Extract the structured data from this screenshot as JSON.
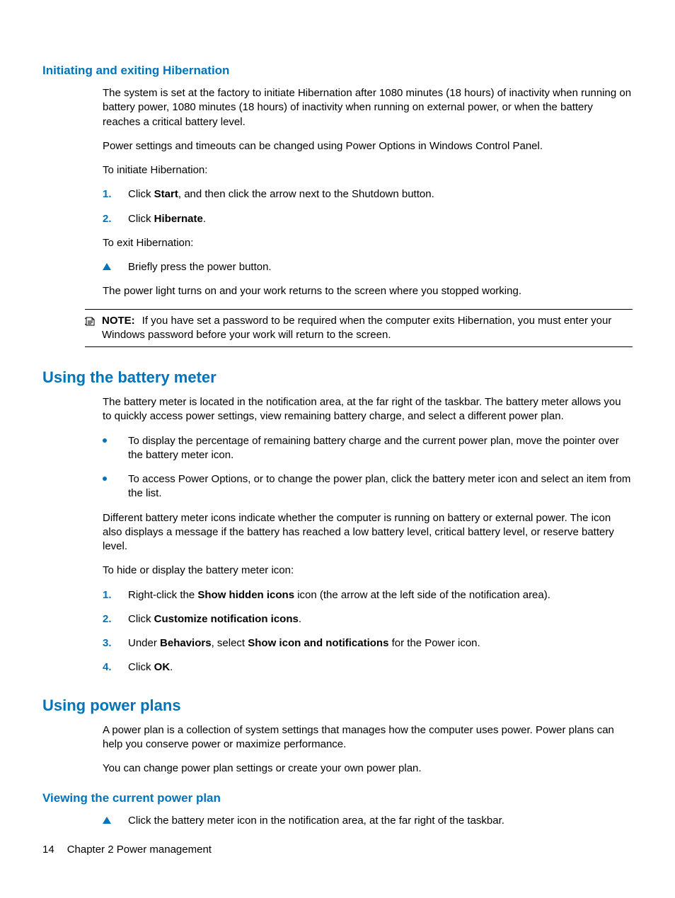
{
  "sec1": {
    "heading": "Initiating and exiting Hibernation",
    "p1": "The system is set at the factory to initiate Hibernation after 1080 minutes (18 hours) of inactivity when running on battery power, 1080 minutes (18 hours) of inactivity when running on external power, or when the battery reaches a critical battery level.",
    "p2": "Power settings and timeouts can be changed using Power Options in Windows Control Panel.",
    "p3": "To initiate Hibernation:",
    "ol1": {
      "n1": "1.",
      "t1a": "Click ",
      "t1b": "Start",
      "t1c": ", and then click the arrow next to the Shutdown button.",
      "n2": "2.",
      "t2a": "Click ",
      "t2b": "Hibernate",
      "t2c": "."
    },
    "p4": "To exit Hibernation:",
    "tri1": "Briefly press the power button.",
    "p5": "The power light turns on and your work returns to the screen where you stopped working.",
    "noteLabel": "NOTE:",
    "noteText": "If you have set a password to be required when the computer exits Hibernation, you must enter your Windows password before your work will return to the screen."
  },
  "sec2": {
    "heading": "Using the battery meter",
    "p1": "The battery meter is located in the notification area, at the far right of the taskbar. The battery meter allows you to quickly access power settings, view remaining battery charge, and select a different power plan.",
    "b1": "To display the percentage of remaining battery charge and the current power plan, move the pointer over the battery meter icon.",
    "b2": "To access Power Options, or to change the power plan, click the battery meter icon and select an item from the list.",
    "p2": "Different battery meter icons indicate whether the computer is running on battery or external power. The icon also displays a message if the battery has reached a low battery level, critical battery level, or reserve battery level.",
    "p3": "To hide or display the battery meter icon:",
    "ol1": {
      "n1": "1.",
      "t1a": "Right-click the ",
      "t1b": "Show hidden icons",
      "t1c": " icon (the arrow at the left side of the notification area).",
      "n2": "2.",
      "t2a": "Click ",
      "t2b": "Customize notification icons",
      "t2c": ".",
      "n3": "3.",
      "t3a": "Under ",
      "t3b": "Behaviors",
      "t3c": ", select ",
      "t3d": "Show icon and notifications",
      "t3e": " for the Power icon.",
      "n4": "4.",
      "t4a": "Click ",
      "t4b": "OK",
      "t4c": "."
    }
  },
  "sec3": {
    "heading": "Using power plans",
    "p1": "A power plan is a collection of system settings that manages how the computer uses power. Power plans can help you conserve power or maximize performance.",
    "p2": "You can change power plan settings or create your own power plan."
  },
  "sec4": {
    "heading": "Viewing the current power plan",
    "tri1": "Click the battery meter icon in the notification area, at the far right of the taskbar."
  },
  "footer": {
    "page": "14",
    "chapter": "Chapter 2   Power management"
  }
}
